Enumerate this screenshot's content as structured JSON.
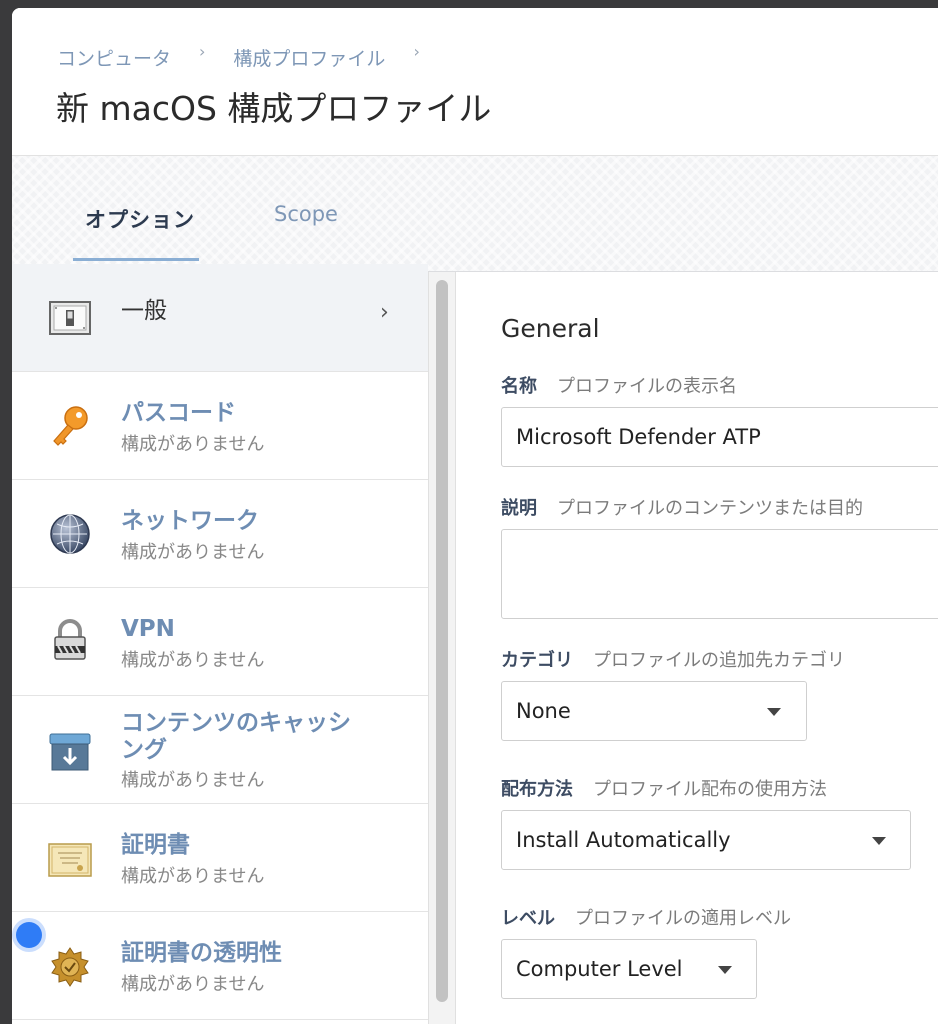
{
  "breadcrumb": {
    "item1": "コンピュータ",
    "item2": "構成プロファイル"
  },
  "page_title": "新 macOS 構成プロファイル",
  "tabs": {
    "options": "オプション",
    "scope": "Scope"
  },
  "sidebar": {
    "items": [
      {
        "title": "一般",
        "subtitle": "",
        "icon": "switch-icon"
      },
      {
        "title": "パスコード",
        "subtitle": "構成がありません",
        "icon": "key-icon"
      },
      {
        "title": "ネットワーク",
        "subtitle": "構成がありません",
        "icon": "globe-icon"
      },
      {
        "title": "VPN",
        "subtitle": "構成がありません",
        "icon": "lock-icon"
      },
      {
        "title": "コンテンツのキャッシ",
        "title2": "ング",
        "subtitle": "構成がありません",
        "icon": "cache-box-icon"
      },
      {
        "title": "証明書",
        "subtitle": "構成がありません",
        "icon": "certificate-icon"
      },
      {
        "title": "証明書の透明性",
        "subtitle": "構成がありません",
        "icon": "seal-icon"
      }
    ]
  },
  "general": {
    "section_title": "General",
    "name": {
      "label": "名称",
      "desc": "プロファイルの表示名",
      "value": "Microsoft Defender ATP"
    },
    "description": {
      "label": "説明",
      "desc": "プロファイルのコンテンツまたは目的",
      "value": ""
    },
    "category": {
      "label": "カテゴリ",
      "desc": "プロファイルの追加先カテゴリ",
      "value": "None"
    },
    "distribution": {
      "label": "配布方法",
      "desc": "プロファイル配布の使用方法",
      "value": "Install Automatically"
    },
    "level": {
      "label": "レベル",
      "desc": "プロファイルの適用レベル",
      "value": "Computer Level"
    }
  },
  "colors": {
    "accent": "#8aaed4",
    "link": "#7e97b6",
    "label": "#3d4c63",
    "dot": "#2f7cf6"
  }
}
